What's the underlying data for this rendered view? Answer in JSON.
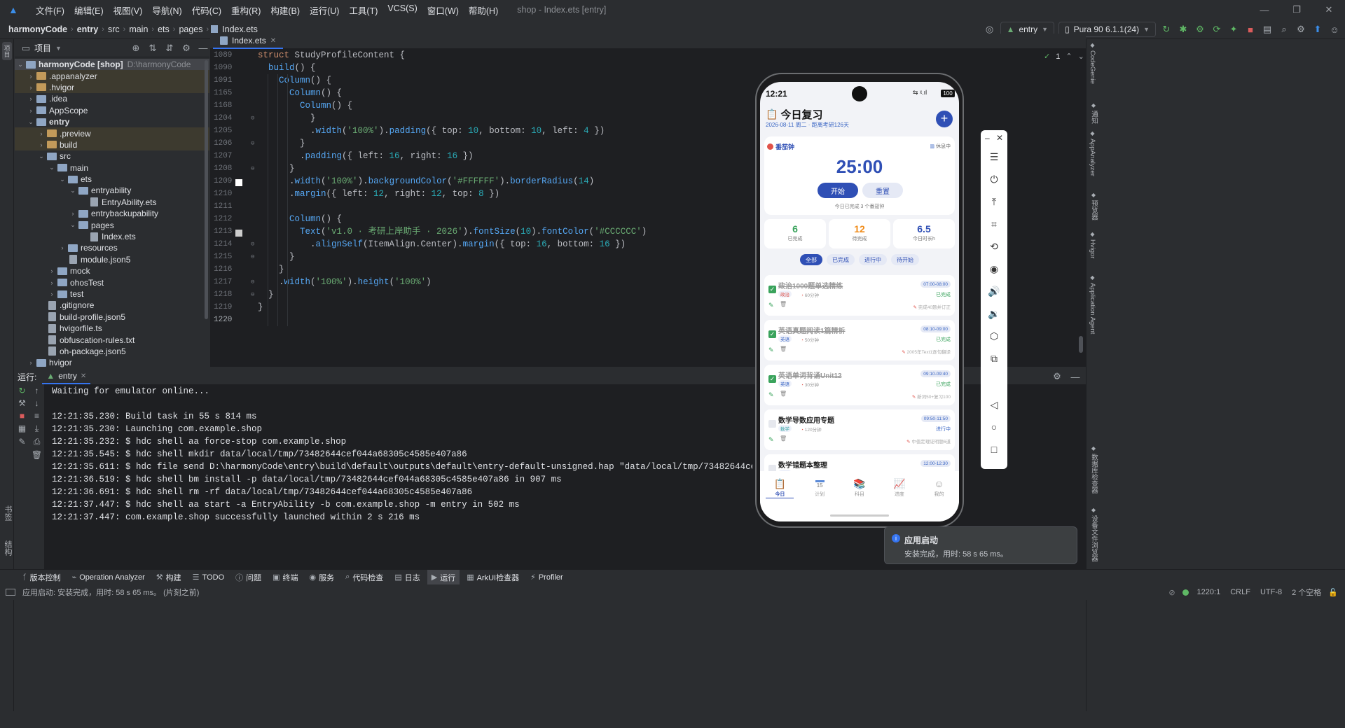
{
  "menubar": {
    "items": [
      "文件(F)",
      "编辑(E)",
      "视图(V)",
      "导航(N)",
      "代码(C)",
      "重构(R)",
      "构建(B)",
      "运行(U)",
      "工具(T)",
      "VCS(S)",
      "窗口(W)",
      "帮助(H)"
    ],
    "title": "shop - Index.ets [entry]"
  },
  "breadcrumb": [
    "harmonyCode",
    "entry",
    "src",
    "main",
    "ets",
    "pages",
    "Index.ets"
  ],
  "toolbar": {
    "module": "entry",
    "device": "Pura 90 6.1.1(24)"
  },
  "project": {
    "header": "项目",
    "root_name": "harmonyCode [shop]",
    "root_path": "D:\\harmonyCode",
    "rows": [
      {
        "label": ".appanalyzer",
        "depth": 1,
        "chev": "›",
        "kind": "folder-or",
        "ex": true
      },
      {
        "label": ".hvigor",
        "depth": 1,
        "chev": "›",
        "kind": "folder-or",
        "ex": true
      },
      {
        "label": ".idea",
        "depth": 1,
        "chev": "›",
        "kind": "folder"
      },
      {
        "label": "AppScope",
        "depth": 1,
        "chev": "›",
        "kind": "folder"
      },
      {
        "label": "entry",
        "depth": 1,
        "chev": "⌄",
        "kind": "folder",
        "bold": true
      },
      {
        "label": ".preview",
        "depth": 2,
        "chev": "›",
        "kind": "folder-or",
        "ex": true
      },
      {
        "label": "build",
        "depth": 2,
        "chev": "›",
        "kind": "folder-or",
        "ex": true
      },
      {
        "label": "src",
        "depth": 2,
        "chev": "⌄",
        "kind": "folder"
      },
      {
        "label": "main",
        "depth": 3,
        "chev": "⌄",
        "kind": "folder"
      },
      {
        "label": "ets",
        "depth": 4,
        "chev": "⌄",
        "kind": "folder"
      },
      {
        "label": "entryability",
        "depth": 5,
        "chev": "⌄",
        "kind": "folder"
      },
      {
        "label": "EntryAbility.ets",
        "depth": 6,
        "chev": "",
        "kind": "file"
      },
      {
        "label": "entrybackupability",
        "depth": 5,
        "chev": "›",
        "kind": "folder"
      },
      {
        "label": "pages",
        "depth": 5,
        "chev": "⌄",
        "kind": "folder"
      },
      {
        "label": "Index.ets",
        "depth": 6,
        "chev": "",
        "kind": "file"
      },
      {
        "label": "resources",
        "depth": 4,
        "chev": "›",
        "kind": "folder"
      },
      {
        "label": "module.json5",
        "depth": 4,
        "chev": "",
        "kind": "file"
      },
      {
        "label": "mock",
        "depth": 3,
        "chev": "›",
        "kind": "folder"
      },
      {
        "label": "ohosTest",
        "depth": 3,
        "chev": "›",
        "kind": "folder"
      },
      {
        "label": "test",
        "depth": 3,
        "chev": "›",
        "kind": "folder"
      },
      {
        "label": ".gitignore",
        "depth": 2,
        "chev": "",
        "kind": "file"
      },
      {
        "label": "build-profile.json5",
        "depth": 2,
        "chev": "",
        "kind": "file"
      },
      {
        "label": "hvigorfile.ts",
        "depth": 2,
        "chev": "",
        "kind": "file"
      },
      {
        "label": "obfuscation-rules.txt",
        "depth": 2,
        "chev": "",
        "kind": "file"
      },
      {
        "label": "oh-package.json5",
        "depth": 2,
        "chev": "",
        "kind": "file"
      },
      {
        "label": "hvigor",
        "depth": 1,
        "chev": "›",
        "kind": "folder"
      },
      {
        "label": "oh_modules",
        "depth": 1,
        "chev": "›",
        "kind": "folder-or",
        "ex": true
      }
    ]
  },
  "editor": {
    "tab": "Index.ets",
    "line_numbers": [
      "1089",
      "1090",
      "1091",
      "1165",
      "1168",
      "1204",
      "1205",
      "1206",
      "1207",
      "1208",
      "1209",
      "1210",
      "1211",
      "1212",
      "1213",
      "1214",
      "1215",
      "1216",
      "1217",
      "1218",
      "1219",
      "1220"
    ],
    "lines": [
      "<span class='kw'>struct</span> StudyProfileContent {",
      "  <span class='fn'>build</span>() {",
      "    <span class='fn'>Column</span>() {",
      "      <span class='fn'>Column</span>() {",
      "        <span class='fn'>Column</span>() {",
      "          }",
      "          .<span class='fn'>width</span>(<span class='st'>'100%'</span>).<span class='fn'>padding</span>({ top: <span class='nu'>10</span>, bottom: <span class='nu'>10</span>, left: <span class='nu'>4</span> })",
      "        }",
      "        .<span class='fn'>padding</span>({ left: <span class='nu'>16</span>, right: <span class='nu'>16</span> })",
      "      }",
      "      .<span class='fn'>width</span>(<span class='st'>'100%'</span>).<span class='fn'>backgroundColor</span>(<span class='st'>'#FFFFFF'</span>).<span class='fn'>borderRadius</span>(<span class='nu'>14</span>)",
      "      .<span class='fn'>margin</span>({ left: <span class='nu'>12</span>, right: <span class='nu'>12</span>, top: <span class='nu'>8</span> })",
      "",
      "      <span class='fn'>Column</span>() {",
      "        <span class='fn'>Text</span>(<span class='st'>'v1.0 · 考研上岸助手 · 2026'</span>).<span class='fn'>fontSize</span>(<span class='nu'>10</span>).<span class='fn'>fontColor</span>(<span class='st'>'#CCCCCC'</span>)",
      "          .<span class='fn'>alignSelf</span>(ItemAlign.Center).<span class='fn'>margin</span>({ top: <span class='nu'>16</span>, bottom: <span class='nu'>16</span> })",
      "      }",
      "    }",
      "    .<span class='fn'>width</span>(<span class='st'>'100%'</span>).<span class='fn'>height</span>(<span class='st'>'100%'</span>)",
      "  }",
      "}",
      ""
    ],
    "inspection": "1"
  },
  "run": {
    "label": "运行:",
    "tab": "entry",
    "console": [
      "Waiting for emulator online...",
      "",
      "12:21:35.230: Build task in 55 s 814 ms",
      "12:21:35.230: Launching com.example.shop",
      "12:21:35.232: $ hdc shell aa force-stop com.example.shop",
      "12:21:35.545: $ hdc shell mkdir data/local/tmp/73482644cef044a68305c4585e407a86",
      "12:21:35.611: $ hdc file send D:\\harmonyCode\\entry\\build\\default\\outputs\\default\\entry-default-unsigned.hap \"data/local/tmp/73482644cef044a68305c4585e407a86",
      "12:21:36.519: $ hdc shell bm install -p data/local/tmp/73482644cef044a68305c4585e407a86 in 907 ms",
      "12:21:36.691: $ hdc shell rm -rf data/local/tmp/73482644cef044a68305c4585e407a86",
      "12:21:37.447: $ hdc shell aa start -a EntryAbility -b com.example.shop -m entry in 502 ms",
      "12:21:37.447: com.example.shop successfully launched within 2 s 216 ms"
    ]
  },
  "left_stripe": [
    "项目",
    "书签",
    "结构"
  ],
  "right_stripe": [
    "CodeGenie",
    "通知",
    "AppAnalyzer",
    "预览器",
    "Hvigor",
    "Application Agent",
    "数据库检查器",
    "设备文件浏览器"
  ],
  "bottom_tools": [
    {
      "icon": "branch-icon",
      "label": "版本控制"
    },
    {
      "icon": "analyzer-icon",
      "label": "Operation Analyzer"
    },
    {
      "icon": "hammer-icon",
      "label": "构建"
    },
    {
      "icon": "list-icon",
      "label": "TODO"
    },
    {
      "icon": "info-icon",
      "label": "问题"
    },
    {
      "icon": "terminal-icon",
      "label": "终端"
    },
    {
      "icon": "service-icon",
      "label": "服务"
    },
    {
      "icon": "inspect-icon",
      "label": "代码检查"
    },
    {
      "icon": "log-icon",
      "label": "日志"
    },
    {
      "icon": "play-icon",
      "label": "运行",
      "active": true
    },
    {
      "icon": "arkui-icon",
      "label": "ArkUI检查器"
    },
    {
      "icon": "profiler-icon",
      "label": "Profiler"
    }
  ],
  "status": {
    "message": "应用启动: 安装完成，用时: 58 s 65 ms。 (片刻之前)",
    "position": "1220:1",
    "line_ending": "CRLF",
    "encoding": "UTF-8",
    "indent": "2 个空格"
  },
  "notification": {
    "title": "应用启动",
    "body": "安装完成，用时: 58 s 65 ms。"
  },
  "phone": {
    "time": "12:21",
    "battery": "100",
    "app_title": "今日复习",
    "date_line": "2026-08-11 周二 · 距离考研126天",
    "pomodoro": {
      "label": "番茄钟",
      "status": "休息中",
      "timer": "25:00",
      "start": "开始",
      "reset": "重置",
      "done_text": "今日已完成 3 个番茄钟"
    },
    "stats": [
      {
        "value": "6",
        "label": "已完成",
        "color": "#3aa35c"
      },
      {
        "value": "12",
        "label": "待完成",
        "color": "#f08c1a"
      },
      {
        "value": "6.5",
        "label": "今日时长h",
        "color": "#2f4fb5"
      }
    ],
    "filters": [
      {
        "label": "全部",
        "active": true
      },
      {
        "label": "已完成"
      },
      {
        "label": "进行中"
      },
      {
        "label": "待开始"
      }
    ],
    "tasks": [
      {
        "title": "政治1000题单选精练",
        "done": true,
        "subject": "政治",
        "subject_color": "#e0524a",
        "duration": "60分钟",
        "time": "07:00-08:00",
        "status": "已完成",
        "status_color": "#3aa35c",
        "note": "完成40题并订正"
      },
      {
        "title": "英语真题阅读1篇精析",
        "done": true,
        "subject": "英语",
        "subject_color": "#3a66c4",
        "duration": "50分钟",
        "time": "08:10-09:00",
        "status": "已完成",
        "status_color": "#3aa35c",
        "note": "2005年Text1逐句翻译"
      },
      {
        "title": "英语单词背诵Unit12",
        "done": true,
        "subject": "英语",
        "subject_color": "#3a66c4",
        "duration": "30分钟",
        "time": "09:10-09:40",
        "status": "已完成",
        "status_color": "#3aa35c",
        "note": "新词50+复习100"
      },
      {
        "title": "数学导数应用专题",
        "done": false,
        "subject": "数学",
        "subject_color": "#2fa0a0",
        "duration": "120分钟",
        "time": "09:50-11:50",
        "status": "进行中",
        "status_color": "#3a66c4",
        "note": "中值定理证明题6道"
      },
      {
        "title": "数学错题本整理",
        "done": false,
        "subject": "数学",
        "subject_color": "#2fa0a0",
        "duration": "",
        "time": "12:00-12:30",
        "status": "待开始",
        "status_color": "#f08c1a",
        "note": ""
      }
    ],
    "nav": [
      {
        "label": "今日",
        "active": true
      },
      {
        "label": "计划"
      },
      {
        "label": "科目"
      },
      {
        "label": "进度"
      },
      {
        "label": "我的"
      }
    ],
    "calendar_num": "15"
  }
}
